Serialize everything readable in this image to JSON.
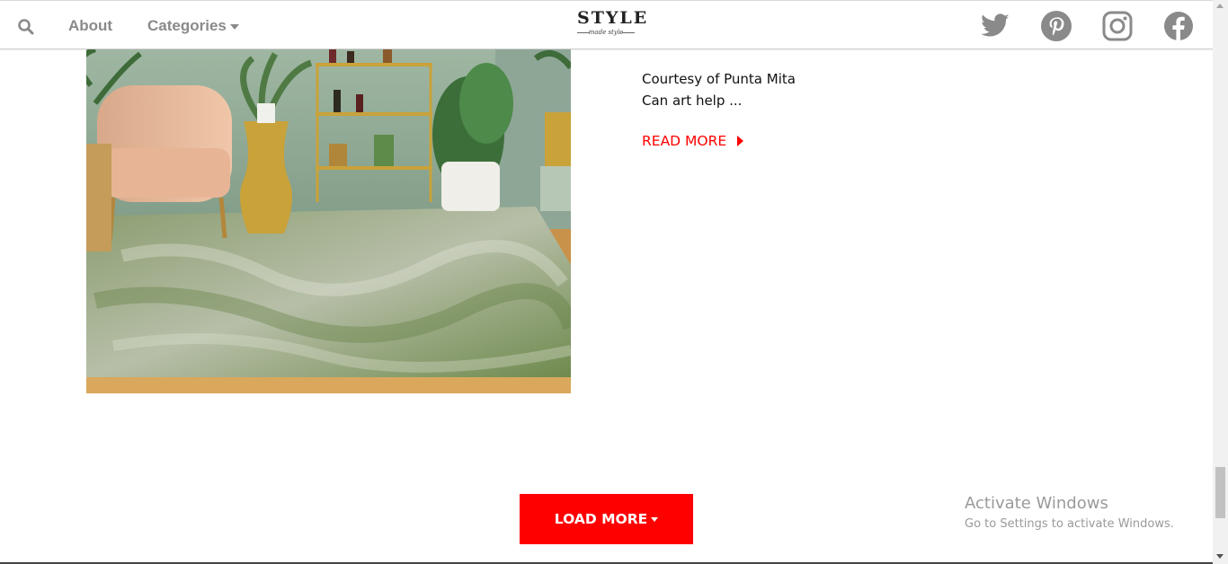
{
  "header": {
    "search_icon": "search-icon",
    "nav": {
      "about": "About",
      "categories": "Categories"
    },
    "logo": {
      "main": "STYLE",
      "sub": "made style"
    },
    "social_icons": [
      "twitter-icon",
      "pinterest-icon",
      "instagram-icon",
      "facebook-icon"
    ],
    "icon_color": "#8a8a8a"
  },
  "article": {
    "excerpt_line1": "Courtesy of Punta Mita",
    "excerpt_line2": "Can art help ...",
    "read_more": "READ MORE"
  },
  "load_more": {
    "label": "LOAD MORE"
  },
  "colors": {
    "accent": "#ff0000",
    "text": "#111111",
    "muted": "#8a8a8a"
  },
  "watermark": {
    "title": "Activate Windows",
    "subtitle": "Go to Settings to activate Windows."
  }
}
